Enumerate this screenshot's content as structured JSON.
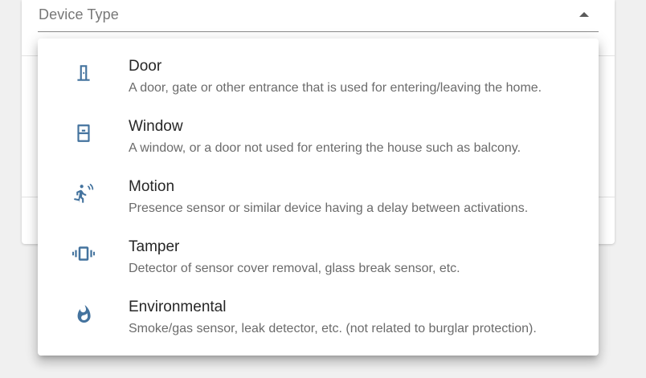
{
  "select": {
    "label": "Device Type"
  },
  "menu": {
    "items": [
      {
        "title": "Door",
        "description": "A door, gate or other entrance that is used for entering/leaving the home.",
        "icon": "door-icon"
      },
      {
        "title": "Window",
        "description": "A window, or a door not used for entering the house such as balcony.",
        "icon": "window-icon"
      },
      {
        "title": "Motion",
        "description": "Presence sensor or similar device having a delay between activations.",
        "icon": "motion-sensor-icon"
      },
      {
        "title": "Tamper",
        "description": "Detector of sensor cover removal, glass break sensor, etc.",
        "icon": "vibrate-icon"
      },
      {
        "title": "Environmental",
        "description": "Smoke/gas sensor, leak detector, etc. (not related to burglar protection).",
        "icon": "fire-icon"
      }
    ]
  },
  "colors": {
    "icon": "#44739e",
    "title": "#262626",
    "description": "#6b6b6b",
    "label": "#777777"
  }
}
